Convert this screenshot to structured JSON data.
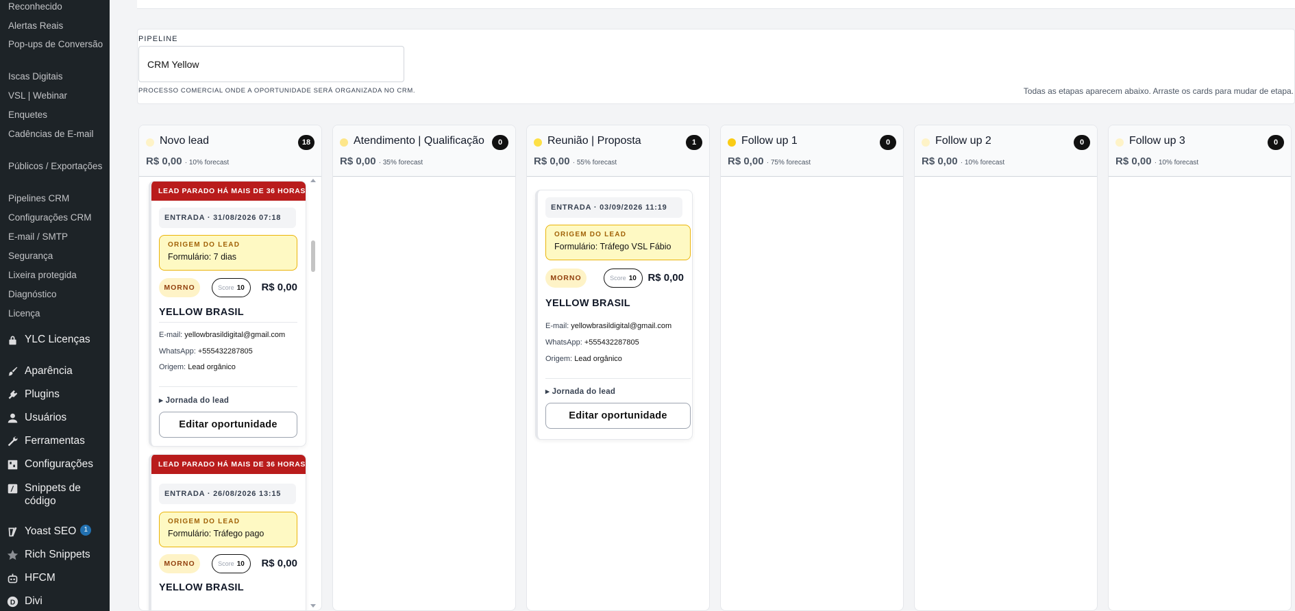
{
  "sidebar": {
    "sub_items": [
      "Reconhecido",
      "Alertas Reais",
      "Pop-ups de Conversão",
      "Iscas Digitais",
      "VSL | Webinar",
      "Enquetes",
      "Cadências de E-mail",
      "Públicos / Exportações",
      "Pipelines CRM",
      "Configurações CRM",
      "E-mail / SMTP",
      "Segurança",
      "Lixeira protegida",
      "Diagnóstico",
      "Licença"
    ],
    "menu": [
      {
        "label": "YLC Licenças",
        "icon": "lock-icon"
      },
      {
        "label": "Aparência",
        "icon": "paintbrush-icon"
      },
      {
        "label": "Plugins",
        "icon": "plugin-icon"
      },
      {
        "label": "Usuários",
        "icon": "users-icon"
      },
      {
        "label": "Ferramentas",
        "icon": "wrench-icon"
      },
      {
        "label": "Configurações",
        "icon": "settings-icon"
      },
      {
        "label": "Snippets de código",
        "icon": "code-snippets-icon"
      },
      {
        "label": "Yoast SEO",
        "icon": "yoast-icon",
        "badge": "1"
      },
      {
        "label": "Rich Snippets",
        "icon": "star-icon"
      },
      {
        "label": "HFCM",
        "icon": "robot-icon"
      },
      {
        "label": "Divi",
        "icon": "divi-icon"
      }
    ]
  },
  "pipeline": {
    "label": "PIPELINE",
    "selected": "CRM Yellow",
    "help": "PROCESSO COMERCIAL ONDE A OPORTUNIDADE SERÁ ORGANIZADA NO CRM.",
    "hint": "Todas as etapas aparecem abaixo. Arraste os cards para mudar de etapa."
  },
  "columns": [
    {
      "title": "Novo lead",
      "count": "18",
      "sum": "R$ 0,00",
      "forecast": "· 10% forecast"
    },
    {
      "title": "Atendimento | Qualificação",
      "count": "0",
      "sum": "R$ 0,00",
      "forecast": "· 35% forecast"
    },
    {
      "title": "Reunião | Proposta",
      "count": "1",
      "sum": "R$ 0,00",
      "forecast": "· 55% forecast"
    },
    {
      "title": "Follow up 1",
      "count": "0",
      "sum": "R$ 0,00",
      "forecast": "· 75% forecast"
    },
    {
      "title": "Follow up 2",
      "count": "0",
      "sum": "R$ 0,00",
      "forecast": "· 10% forecast"
    },
    {
      "title": "Follow up 3",
      "count": "0",
      "sum": "R$ 0,00",
      "forecast": "· 10% forecast"
    }
  ],
  "cards": [
    {
      "banner": "LEAD PARADO HÁ MAIS DE 36 HORAS",
      "entry": "ENTRADA · 31/08/2026 07:18",
      "origin_label": "ORIGEM DO LEAD",
      "origin_value": "Formulário: 7 dias",
      "temperature": "MORNO",
      "score_label": "Score",
      "score_value": "10",
      "value": "R$ 0,00",
      "company": "YELLOW BRASIL",
      "email_label": "E-mail:",
      "email": "yellowbrasildigital@gmail.com",
      "whatsapp_label": "WhatsApp:",
      "whatsapp": "+555432287805",
      "origem_label": "Origem:",
      "origem": "Lead orgânico",
      "journey": "▸ Jornada do lead",
      "edit": "Editar oportunidade"
    },
    {
      "banner": "LEAD PARADO HÁ MAIS DE 36 HORAS",
      "entry": "ENTRADA · 26/08/2026 13:15",
      "origin_label": "ORIGEM DO LEAD",
      "origin_value": "Formulário: Tráfego pago",
      "temperature": "MORNO",
      "score_label": "Score",
      "score_value": "10",
      "value": "R$ 0,00",
      "company": "YELLOW BRASIL"
    },
    {
      "entry": "ENTRADA · 03/09/2026 11:19",
      "origin_label": "ORIGEM DO LEAD",
      "origin_value": "Formulário: Tráfego VSL Fábio",
      "temperature": "MORNO",
      "score_label": "Score",
      "score_value": "10",
      "value": "R$ 0,00",
      "company": "YELLOW BRASIL",
      "email_label": "E-mail:",
      "email": "yellowbrasildigital@gmail.com",
      "whatsapp_label": "WhatsApp:",
      "whatsapp": "+555432287805",
      "origem_label": "Origem:",
      "origem": "Lead orgânico",
      "journey": "▸ Jornada do lead",
      "edit": "Editar oportunidade"
    }
  ],
  "colors": {
    "sidebar_bg": "#1d2327",
    "banner": "#b91c1c",
    "origin_bg": "#fef9c3",
    "origin_border": "#eab308",
    "dot": "#facc15"
  }
}
